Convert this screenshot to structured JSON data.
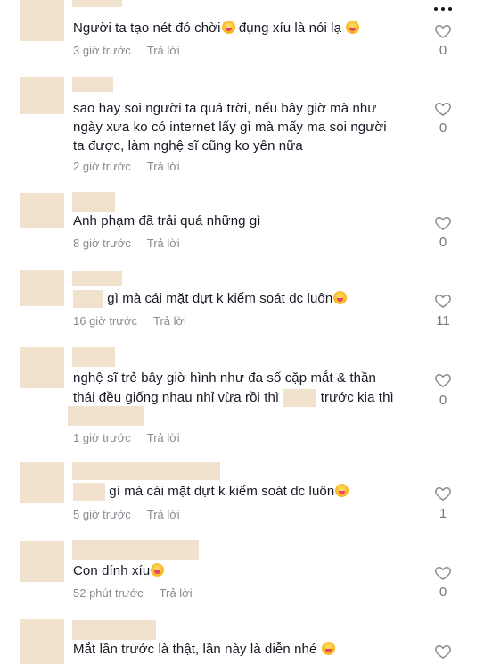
{
  "comments": [
    {
      "text": "Người ta tạo nét đó chời",
      "text_b": " đụng xíu là nói lạ",
      "time": "3 giờ trước",
      "reply": "Trả lời",
      "likes": "0"
    },
    {
      "lines": [
        "sao hay soi người ta quá trời, nếu bây giờ mà như",
        "ngày xưa ko có internet lấy gì mà mấy ma soi người",
        "ta được, làm nghệ sĩ cũng ko yên nữa"
      ],
      "time": "2 giờ trước",
      "reply": "Trả lời",
      "likes": "0"
    },
    {
      "text": "Anh phạm đã trải quá những gì",
      "time": "8 giờ trước",
      "reply": "Trả lời",
      "likes": "0"
    },
    {
      "text": " gì mà cái mặt dựt k kiểm soát dc luôn",
      "time": "16 giờ trước",
      "reply": "Trả lời",
      "likes": "11"
    },
    {
      "line1": "nghệ sĩ trẻ bây giờ hình như đa số cặp mắt & thần",
      "line2a": "thái đều giống nhau nhỉ vừa rồi thì ",
      "line2b": " trước kia thì",
      "time": "1 giờ trước",
      "reply": "Trả lời",
      "likes": "0"
    },
    {
      "text": " gì mà cái mặt dựt k kiểm soát dc luôn",
      "time": "5 giờ trước",
      "reply": "Trả lời",
      "likes": "1"
    },
    {
      "text": "Con dính xíu",
      "time": "52 phút trước",
      "reply": "Trả lời",
      "likes": "0"
    },
    {
      "text": "Mắt lần trước là thật, lần này là diễn nhé ",
      "likes": ""
    }
  ],
  "icons": {
    "more": "more-icon",
    "like": "heart-icon",
    "emoji": "laughing-emoji-icon"
  },
  "colors": {
    "placeholder": "#f1e2cd",
    "meta": "#8a8b91",
    "text": "#161823"
  }
}
